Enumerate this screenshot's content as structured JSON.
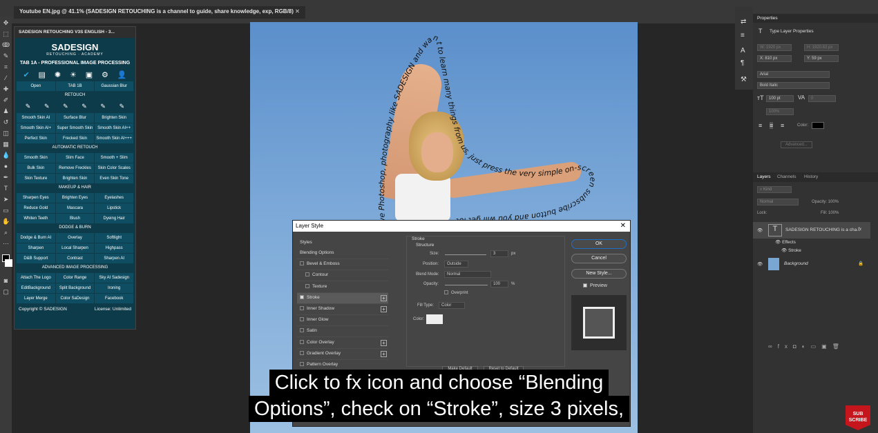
{
  "document": {
    "tab_title": "Youtube EN.jpg @ 41.1% (SADESIGN RETOUCHING is a channel to guide, share knowledge, exp, RGB/8)"
  },
  "plugin": {
    "title": "SADESIGN RETOUCHING V3S ENGLISH - 3...",
    "logo": "SADESIGN",
    "logo_sub": "RETOUCHING · ACADEMY",
    "tab": "TAB 1A - PROFESSIONAL IMAGE PROCESSING",
    "rows": [
      {
        "buttons": [
          "Open",
          "TAB 1B",
          "Gaussian Blur"
        ]
      },
      {
        "section": "RETOUCH"
      },
      {
        "icons": true
      },
      {
        "buttons": [
          "Smooth Skin AI",
          "Surface Blur",
          "Brighten Skin"
        ]
      },
      {
        "buttons": [
          "Smooth Skin AI+",
          "Super Smooth Skin",
          "Smooth Skin AI++"
        ]
      },
      {
        "buttons": [
          "Perfect Skin",
          "Frecked Skin",
          "Smooth Skin AI+++"
        ]
      },
      {
        "section": "AUTOMATIC RETOUCH"
      },
      {
        "buttons": [
          "Smooth Skin",
          "Slim Face",
          "Smooth + Slim"
        ]
      },
      {
        "buttons": [
          "Bulk Skin",
          "Remove Freckles",
          "Skin Color Scales"
        ]
      },
      {
        "buttons": [
          "Skin Texture",
          "Brighten Skin",
          "Even Skin Tone"
        ]
      },
      {
        "section": "MAKEUP & HAIR"
      },
      {
        "buttons": [
          "Sharpen Eyes",
          "Brighten Eyes",
          "Eyelashes"
        ]
      },
      {
        "buttons": [
          "Reduce Gold",
          "Mascara",
          "Lipstick"
        ]
      },
      {
        "buttons": [
          "Whiten Teeth",
          "Blush",
          "Dyeing Hair"
        ]
      },
      {
        "section": "DODGE & BURN"
      },
      {
        "buttons": [
          "Dodge & Burn AI",
          "Overlay",
          "Softlight"
        ]
      },
      {
        "buttons": [
          "Sharpen",
          "Local Sharpen",
          "Highpass"
        ]
      },
      {
        "buttons": [
          "D&B Support",
          "Contrast",
          "Sharpen AI"
        ]
      },
      {
        "section": "ADVANCED IMAGE PROCESSING"
      },
      {
        "buttons": [
          "Attach The Logo",
          "Color Range",
          "Sky AI Sadesign"
        ]
      },
      {
        "buttons": [
          "EditBackground",
          "Split Background",
          "Ironing"
        ]
      },
      {
        "buttons": [
          "Layer Merge",
          "Color SaDesign",
          "Facebook"
        ]
      }
    ],
    "copyright": "Copyright © SADESIGN",
    "license": "License: Unlimited"
  },
  "canvas": {
    "curved_text": "ve Photoshop, photography like SADESIGN and want to learn many things from us, just press the very simple on-screen subscribe button and you will get lots of free"
  },
  "properties": {
    "title": "Properties",
    "type_label": "Type Layer Properties",
    "w": "W: 1920 px",
    "h": "H: 1920.83 px",
    "x": "X: 810 px",
    "y": "Y: 59 px",
    "font": "Arial",
    "style": "Bold Italic",
    "size": "100 pt",
    "va": "0",
    "tracking": "100%",
    "color_label": "Color:",
    "advanced": "Advanced..."
  },
  "layers": {
    "tabs": [
      "Layers",
      "Channels",
      "History"
    ],
    "kind": "Kind",
    "blend": "Normal",
    "opacity": "Opacity: 100%",
    "fill": "Fill: 100%",
    "lock": "Lock:",
    "text_layer": "SADESIGN RETOUCHING is a cha...",
    "effects": "Effects",
    "stroke": "Stroke",
    "bg": "Background"
  },
  "dialog": {
    "title": "Layer Style",
    "styles_label": "Styles",
    "items": [
      {
        "label": "Blending Options",
        "check": false,
        "indent": false,
        "plus": false
      },
      {
        "label": "Bevel & Emboss",
        "check": true,
        "on": false,
        "indent": false,
        "plus": false
      },
      {
        "label": "Contour",
        "check": true,
        "on": false,
        "indent": true,
        "plus": false
      },
      {
        "label": "Texture",
        "check": true,
        "on": false,
        "indent": true,
        "plus": false
      },
      {
        "label": "Stroke",
        "check": true,
        "on": true,
        "indent": false,
        "plus": true
      },
      {
        "label": "Inner Shadow",
        "check": true,
        "on": false,
        "indent": false,
        "plus": true
      },
      {
        "label": "Inner Glow",
        "check": true,
        "on": false,
        "indent": false,
        "plus": false
      },
      {
        "label": "Satin",
        "check": true,
        "on": false,
        "indent": false,
        "plus": false
      },
      {
        "label": "Color Overlay",
        "check": true,
        "on": false,
        "indent": false,
        "plus": true
      },
      {
        "label": "Gradient Overlay",
        "check": true,
        "on": false,
        "indent": false,
        "plus": true
      },
      {
        "label": "Pattern Overlay",
        "check": true,
        "on": false,
        "indent": false,
        "plus": false
      }
    ],
    "stroke_title": "Stroke",
    "structure": "Structure",
    "size_label": "Size:",
    "size_val": "3",
    "px": "px",
    "position_label": "Position:",
    "position_val": "Outside",
    "blend_label": "Blend Mode:",
    "blend_val": "Normal",
    "opacity_label": "Opacity:",
    "opacity_val": "100",
    "pct": "%",
    "overprint": "Overprint",
    "filltype_label": "Fill Type:",
    "filltype_val": "Color",
    "color_label": "Color:",
    "ok": "OK",
    "cancel": "Cancel",
    "new_style": "New Style...",
    "preview": "Preview",
    "make_default": "Make Default",
    "reset_default": "Reset to Default"
  },
  "subtitle": {
    "line1": "Click to fx icon and choose “Blending",
    "line2": "Options”, check on “Stroke”, size 3 pixels,"
  },
  "badge": {
    "l1": "SUB",
    "l2": "SCRIBE"
  }
}
